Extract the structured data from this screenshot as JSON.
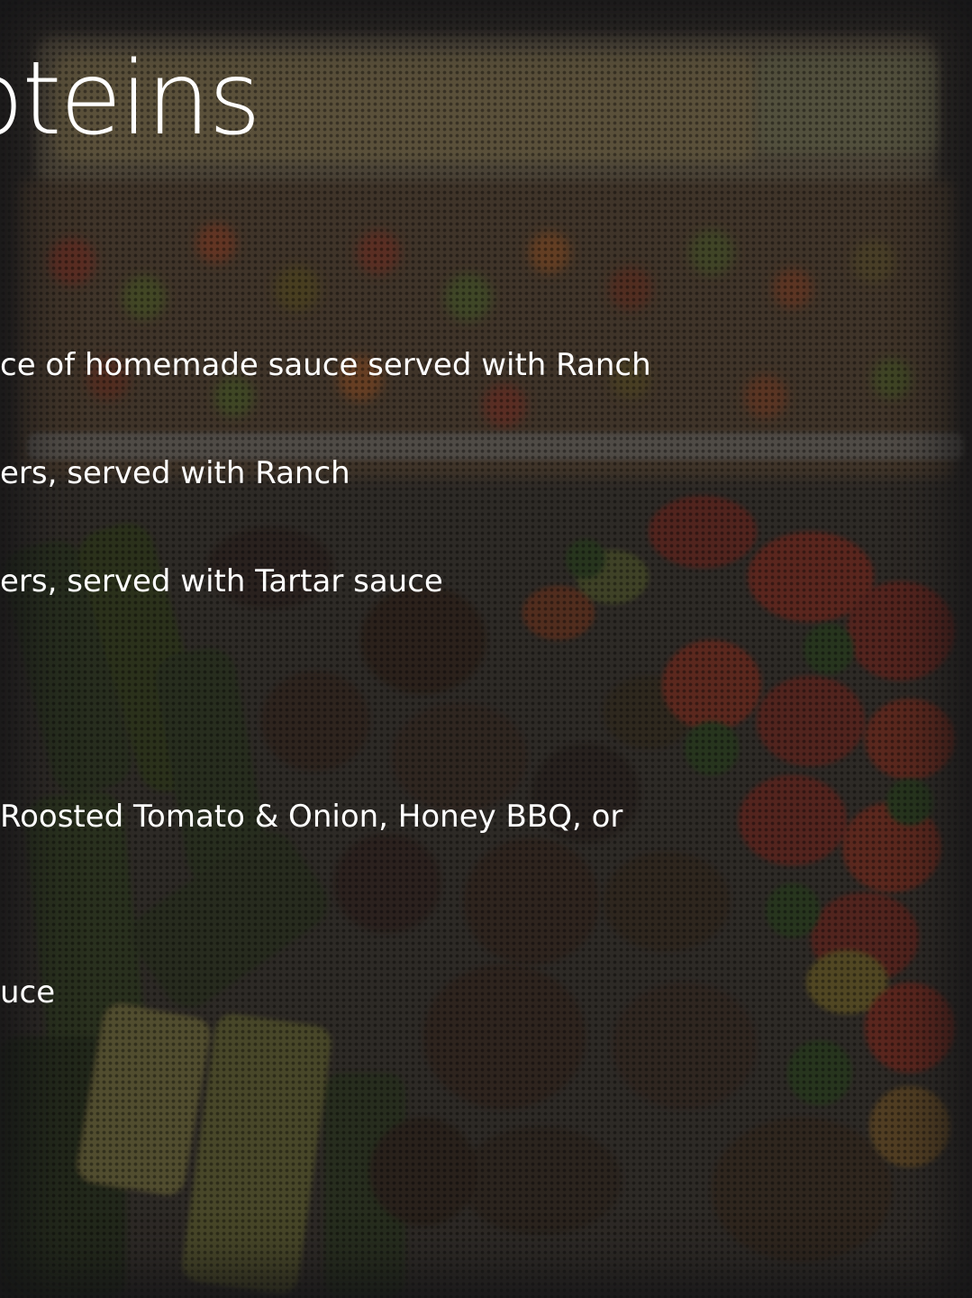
{
  "heading": "oteins",
  "menu_items": [
    "ce of homemade sauce served with Ranch",
    "ers, served with Ranch",
    "ers, served with Tartar sauce",
    "Roosted Tomato & Onion, Honey BBQ, or",
    "uce"
  ],
  "background": {
    "description_icon": "food-photo",
    "overlay_color": "#1e1c1a"
  }
}
